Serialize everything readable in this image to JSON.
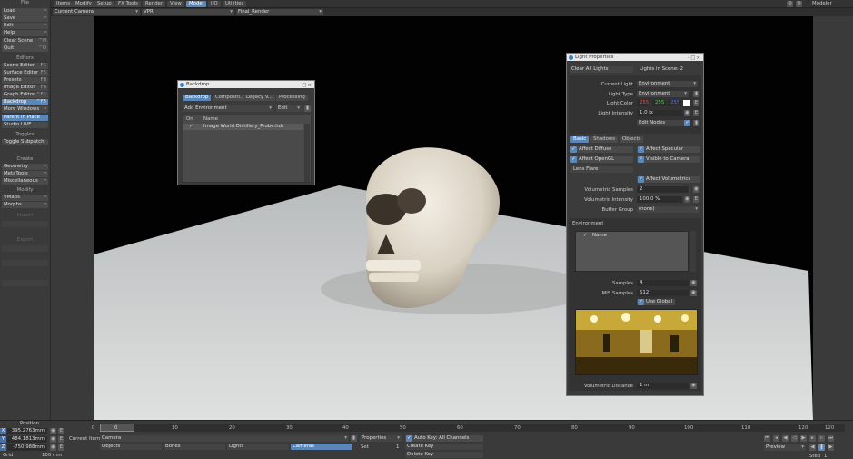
{
  "menu": {
    "file": "File",
    "items": "Items",
    "modify": "Modify",
    "setup": "Setup",
    "fxtools": "FX Tools",
    "render": "Render",
    "view": "View",
    "model": "Model",
    "io": "I/O",
    "utilities": "Utilities",
    "modeler": "Modeler"
  },
  "left": {
    "load": "Load",
    "save": "Save",
    "edit": "Edit",
    "help": "Help",
    "clear_scene": "Clear Scene",
    "clear_scene_key": "^N",
    "quit": "Quit",
    "quit_key": "^Q",
    "editors": "Editors",
    "scene_editor": "Scene Editor",
    "surface_editor": "Surface Editor",
    "presets": "Presets",
    "image_editor": "Image Editor",
    "graph_editor": "Graph Editor",
    "backdrop": "Backdrop",
    "more_windows": "More Windows",
    "parent_in_place": "Parent in Place",
    "studio_live": "Studio LIVE",
    "k_se": "F1",
    "k_sf": "F5",
    "k_pr": "F8",
    "k_ie": "F6",
    "k_ge": "^F2",
    "k_bd": "^F5",
    "toggles": "Toggles",
    "toggle_subpatch": "Toggle Subpatch",
    "create": "Create",
    "geometry": "Geometry",
    "metatools": "MetaTools",
    "miscellaneous": "Miscellaneous",
    "modify": "Modify",
    "vmaps": "VMaps",
    "morphs": "Morphs",
    "import": "Import",
    "export": "Export"
  },
  "viewhead": {
    "camera": "Current Camera",
    "renderer": "VPR",
    "preset": "Final_Render"
  },
  "backdrop_panel": {
    "title": "Backdrop",
    "tabs": [
      "Backdrop",
      "Compositi...",
      "Legacy V...",
      "Processing"
    ],
    "add_env": "Add Environment",
    "edit": "Edit",
    "col_on": "On",
    "col_name": "Name",
    "row_name": "Image World Distillery_Probe.hdr",
    "row_check": "✓"
  },
  "light_panel": {
    "title": "Light Properties",
    "clear_all": "Clear All Lights",
    "lights_in_scene": "Lights in Scene: 2",
    "current_light_lbl": "Current Light",
    "current_light": "Environment",
    "light_type_lbl": "Light Type",
    "light_type": "Environment",
    "light_color_lbl": "Light Color",
    "r": "255",
    "g": "255",
    "b": "255",
    "intensity_lbl": "Light Intensity",
    "intensity": "1.0 lx",
    "edit_nodes": "Edit Nodes",
    "tabs": [
      "Basic",
      "Shadows",
      "Objects"
    ],
    "affect_diffuse": "Affect Diffuse",
    "affect_specular": "Affect Specular",
    "affect_opengl": "Affect OpenGL",
    "visible_to_camera": "Visible to Camera",
    "lens_flare": "Lens Flare",
    "affect_volumetrics": "Affect Volumetrics",
    "vol_samples_lbl": "Volumetric Samples",
    "vol_samples": "2",
    "vol_intensity_lbl": "Volumetric Intensity",
    "vol_intensity": "100.0 %",
    "buffer_group_lbl": "Buffer Group",
    "buffer_group": "(none)",
    "environment": "Environment",
    "name_col": "Name",
    "samples_lbl": "Samples",
    "samples": "4",
    "mis_lbl": "MIS Samples",
    "mis": "512",
    "use_global": "Use Global",
    "vol_dist_lbl": "Volumetric Distance",
    "vol_dist": "1 m"
  },
  "bottom": {
    "position": "Position",
    "x_lbl": "X",
    "y_lbl": "Y",
    "z_lbl": "Z",
    "x": "395.2763mm",
    "y": "484.1813mm",
    "z": "-750.988mm",
    "grid_lbl": "Grid",
    "grid": "100 mm",
    "current_item_lbl": "Current Item",
    "current_item": "Camera",
    "properties": "Properties",
    "auto_key": "Auto Key: All Channels",
    "objects": "Objects",
    "bones": "Bones",
    "lights": "Lights",
    "cameras": "Cameras",
    "set": "Set",
    "set_val": "1",
    "create_key": "Create Key",
    "delete_key": "Delete Key",
    "preview": "Preview",
    "step": "Step",
    "step_val": "1",
    "ticks": [
      "0",
      "10",
      "20",
      "30",
      "40",
      "50",
      "60",
      "70",
      "80",
      "90",
      "100",
      "110",
      "120"
    ],
    "frame": "0",
    "end": "120"
  },
  "colors": {
    "accent": "#5a86b8",
    "red": "#ff4444",
    "green": "#44dd44",
    "blue": "#5577ff"
  }
}
